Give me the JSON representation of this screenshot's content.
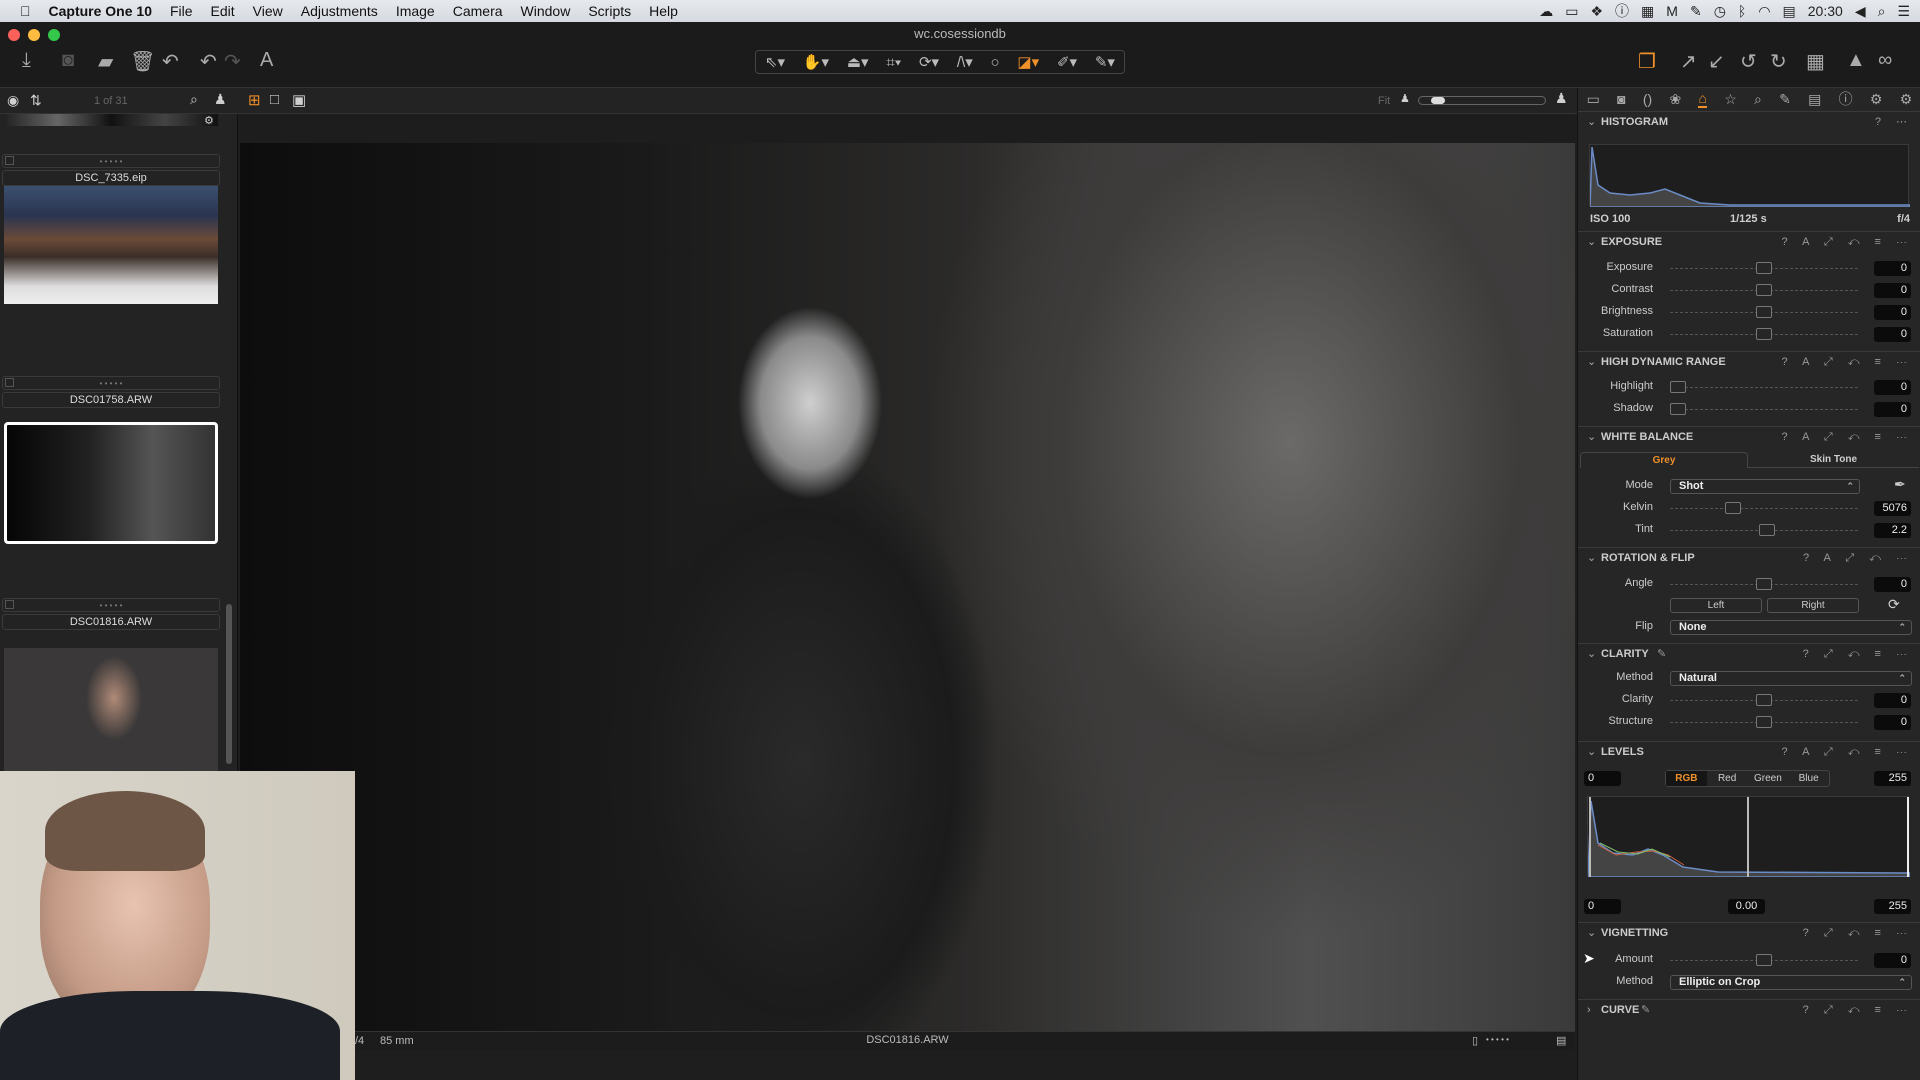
{
  "menubar": {
    "app": "Capture One 10",
    "items": [
      "File",
      "Edit",
      "View",
      "Adjustments",
      "Image",
      "Camera",
      "Window",
      "Scripts",
      "Help"
    ],
    "clock": "20:30"
  },
  "window": {
    "title": "wc.cosessiondb"
  },
  "browser": {
    "counter": "1 of 31",
    "zoom_label": "Fit",
    "thumbs": [
      {
        "name": "DSC_7335.eip"
      },
      {
        "name": "DSC01758.ARW"
      },
      {
        "name": "DSC01816.ARW",
        "selected": true
      }
    ],
    "rating_dots": "• • • • •"
  },
  "viewer": {
    "filename": "DSC01816.ARW",
    "aperture": "/4",
    "focal": "85 mm",
    "dots": "• • • • •"
  },
  "accent_color": "#f0902a",
  "panel": {
    "histogram": {
      "title": "HISTOGRAM",
      "iso": "ISO 100",
      "shutter": "1/125 s",
      "aperture": "f/4"
    },
    "exposure": {
      "title": "EXPOSURE",
      "rows": [
        {
          "label": "Exposure",
          "value": "0",
          "pos": 0.5
        },
        {
          "label": "Contrast",
          "value": "0",
          "pos": 0.5
        },
        {
          "label": "Brightness",
          "value": "0",
          "pos": 0.5
        },
        {
          "label": "Saturation",
          "value": "0",
          "pos": 0.5
        }
      ]
    },
    "hdr": {
      "title": "HIGH DYNAMIC RANGE",
      "rows": [
        {
          "label": "Highlight",
          "value": "0",
          "pos": 0
        },
        {
          "label": "Shadow",
          "value": "0",
          "pos": 0
        }
      ]
    },
    "white_balance": {
      "title": "WHITE BALANCE",
      "tabs": [
        "Grey",
        "Skin Tone"
      ],
      "mode_label": "Mode",
      "mode": "Shot",
      "rows": [
        {
          "label": "Kelvin",
          "value": "5076",
          "pos": 0.32
        },
        {
          "label": "Tint",
          "value": "2.2",
          "pos": 0.52
        }
      ]
    },
    "rotation": {
      "title": "ROTATION & FLIP",
      "rows": [
        {
          "label": "Angle",
          "value": "0",
          "pos": 0.5
        }
      ],
      "left": "Left",
      "right": "Right",
      "flip_label": "Flip",
      "flip": "None"
    },
    "clarity": {
      "title": "CLARITY",
      "method_label": "Method",
      "method": "Natural",
      "rows": [
        {
          "label": "Clarity",
          "value": "0",
          "pos": 0.5
        },
        {
          "label": "Structure",
          "value": "0",
          "pos": 0.5
        }
      ]
    },
    "levels": {
      "title": "LEVELS",
      "channels": [
        "RGB",
        "Red",
        "Green",
        "Blue"
      ],
      "in_low": "0",
      "in_high": "255",
      "out_low": "0",
      "mid": "0.00",
      "out_high": "255"
    },
    "vignetting": {
      "title": "VIGNETTING",
      "rows": [
        {
          "label": "Amount",
          "value": "0",
          "pos": 0.5
        }
      ],
      "method_label": "Method",
      "method": "Elliptic on Crop"
    },
    "curve": {
      "title": "CURVE"
    }
  }
}
